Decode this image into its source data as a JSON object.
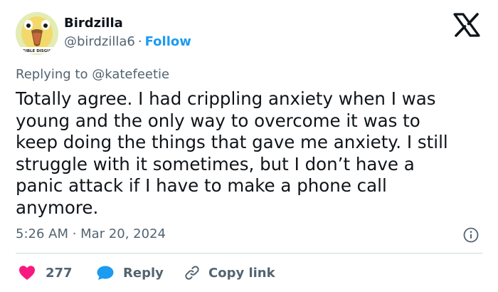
{
  "author": {
    "name": "Birdzilla",
    "handle": "@birdzilla6",
    "separator": "·",
    "follow_label": "Follow",
    "avatar_caption": "VISIBLE DISGUST",
    "avatar_icon": "cartoon-bird-avatar"
  },
  "header": {
    "logo_icon": "x-logo-icon"
  },
  "tweet": {
    "reply_prefix": "Replying to",
    "reply_handle": "@katefeetie",
    "text": "Totally agree. I had crippling anxiety when I was\nyoung and the only way to overcome it was to\nkeep doing the things that gave me anxiety. I still\nstruggle with it sometimes, but I don’t have a\npanic attack if I have to make a phone call\nanymore.",
    "timestamp": "5:26 AM · Mar 20, 2024"
  },
  "actions": {
    "likes": "277",
    "reply_label": "Reply",
    "copy_link_label": "Copy link"
  },
  "colors": {
    "accent": "#1d9bf0",
    "heart": "#f91880",
    "text_primary": "#0f1419",
    "text_secondary": "#536471",
    "divider": "#cfd9de"
  }
}
